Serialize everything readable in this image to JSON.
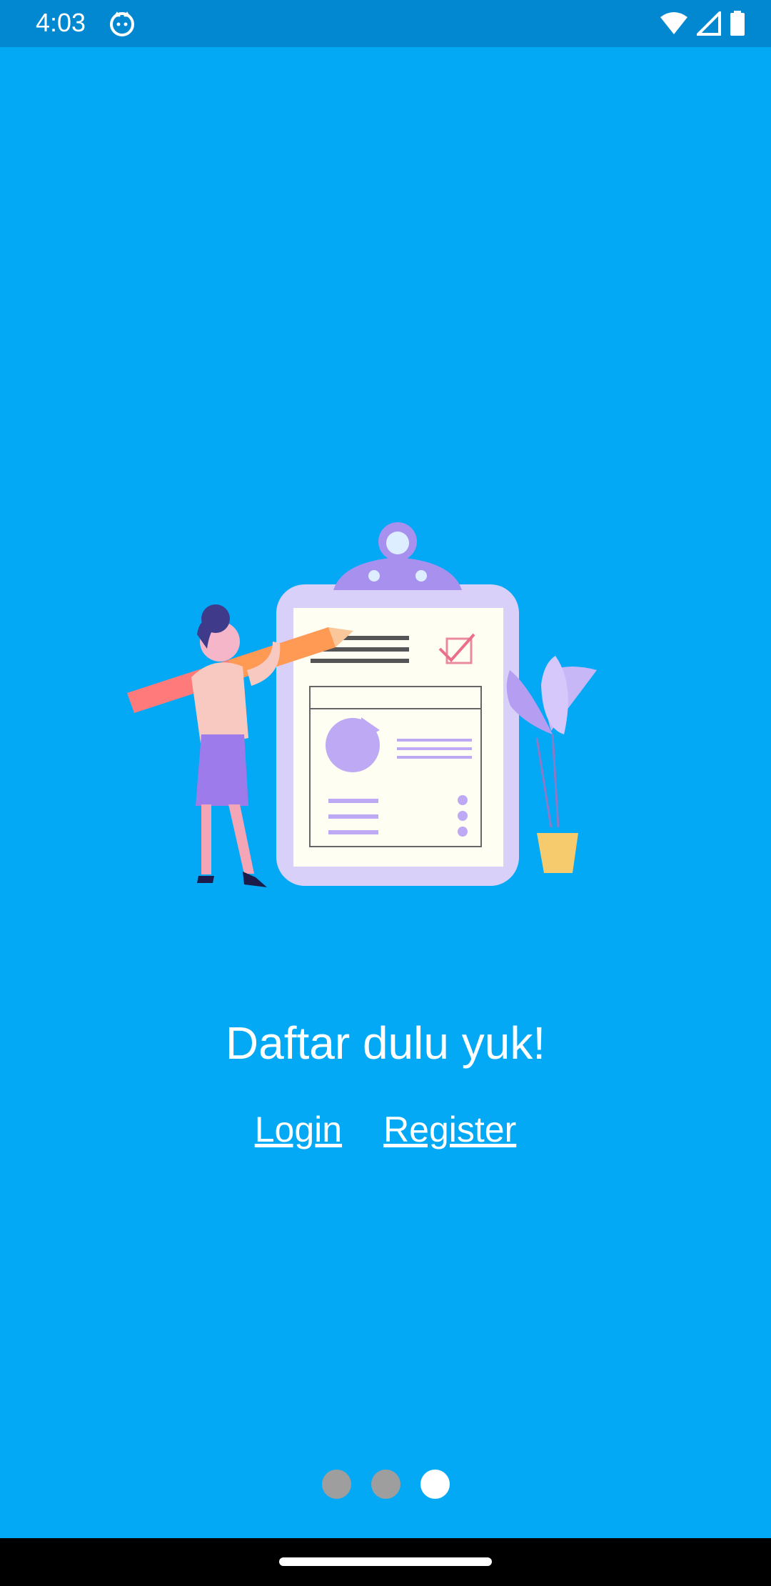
{
  "status_bar": {
    "time": "4:03",
    "icons": [
      "app-notification-icon",
      "wifi-icon",
      "signal-icon",
      "battery-icon"
    ]
  },
  "onboarding": {
    "title": "Daftar dulu yuk!",
    "login_label": "Login",
    "register_label": "Register",
    "page_indicator": {
      "count": 3,
      "active_index": 2
    }
  },
  "colors": {
    "background": "#03A9F4",
    "status_bar": "#0288D1",
    "dot_inactive": "#9E9E9E",
    "dot_active": "#FFFFFF"
  }
}
